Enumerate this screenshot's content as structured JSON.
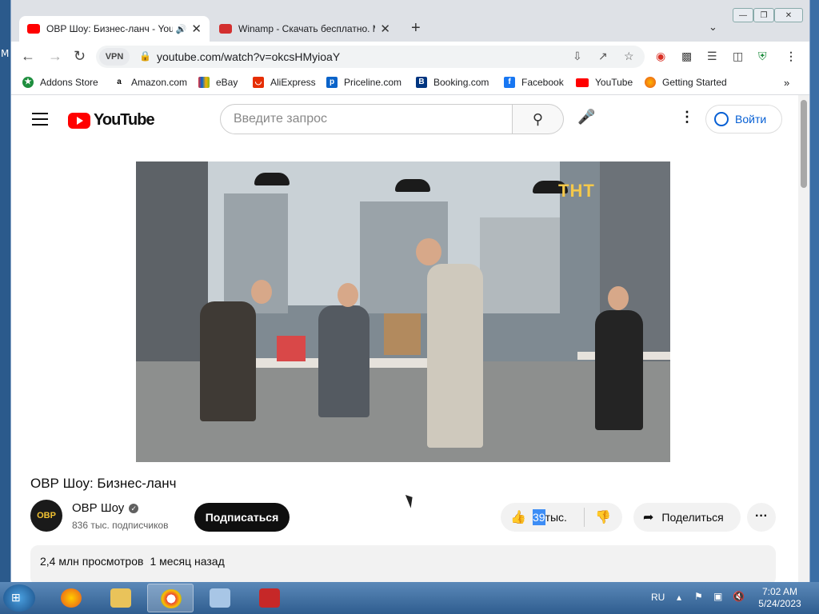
{
  "desktop": {
    "edge_text": "M"
  },
  "browser": {
    "tabs": [
      {
        "title": "ОВР Шоу: Бизнес-ланч - YouTube",
        "favicon_color": "#ff0000",
        "active": true
      },
      {
        "title": "Winamp - Скачать бесплатно. Музыка",
        "favicon_color": "#d32f2f",
        "active": false
      }
    ],
    "address": "youtube.com/watch?v=okcsHMyioaY",
    "vpn_label": "VPN",
    "bookmarks": [
      "Addons Store",
      "Amazon.com",
      "eBay",
      "AliExpress",
      "Priceline.com",
      "Booking.com",
      "Facebook",
      "YouTube",
      "Getting Started"
    ]
  },
  "youtube": {
    "logo_text": "YouTube",
    "search_placeholder": "Введите запрос",
    "signin_label": "Войти",
    "video": {
      "channel_watermark": "ТНТ",
      "title": "ОВР Шоу: Бизнес-ланч",
      "channel_name": "ОВР Шоу",
      "channel_avatar_text": "ОВР",
      "subscribers": "836 тыс. подписчиков",
      "subscribe_label": "Подписаться",
      "likes_highlight": "39",
      "likes_suffix": "тыс.",
      "share_label": "Поделиться",
      "views": "2,4 млн просмотров",
      "age": "1 месяц назад"
    }
  },
  "taskbar": {
    "lang": "RU",
    "time": "7:02 AM",
    "date": "5/24/2023"
  },
  "colors": {
    "youtube_red": "#ff0000",
    "link_blue": "#065fd4",
    "selection_blue": "#3d8df5"
  }
}
